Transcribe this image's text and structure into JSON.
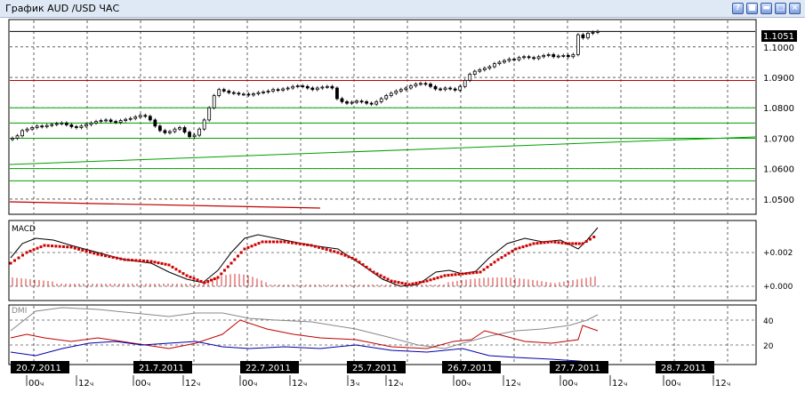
{
  "window": {
    "title": "График AUD /USD  ЧАС",
    "buttons": [
      "help-icon",
      "settings-icon",
      "minimize-icon",
      "maximize-icon",
      "close-icon"
    ],
    "button_glyphs": [
      "?",
      "■",
      "▬",
      "□",
      "×"
    ]
  },
  "price_panel": {
    "current_price": "1.1051",
    "ticks": [
      "1.1000",
      "1.0900",
      "1.0800",
      "1.0700",
      "1.0600",
      "1.0500"
    ]
  },
  "macd_panel": {
    "label": "MACD",
    "ticks": [
      "+0.002",
      "+0.000"
    ]
  },
  "dmi_panel": {
    "label": "DMI",
    "ticks": [
      "40",
      "20"
    ]
  },
  "time_axis": {
    "dates": [
      "20.7.2011",
      "21.7.2011",
      "22.7.2011",
      "25.7.2011",
      "26.7.2011",
      "27.7.2011",
      "28.7.2011"
    ],
    "hours": [
      {
        "h": "00",
        "m": "ч"
      },
      {
        "h": "12",
        "m": "ч"
      },
      {
        "h": "00",
        "m": "ч"
      },
      {
        "h": "12",
        "m": "ч"
      },
      {
        "h": "00",
        "m": "ч"
      },
      {
        "h": "12",
        "m": "ч"
      },
      {
        "h": "3",
        "m": "ч"
      },
      {
        "h": "12",
        "m": "ч"
      },
      {
        "h": "00",
        "m": "ч"
      },
      {
        "h": "12",
        "m": "ч"
      },
      {
        "h": "00",
        "m": "ч"
      },
      {
        "h": "12",
        "m": "ч"
      },
      {
        "h": "00",
        "m": "ч"
      },
      {
        "h": "12",
        "m": "ч"
      }
    ]
  },
  "colors": {
    "candle": "#000000",
    "support": "#00a000",
    "resistance": "#c00000",
    "macd_signal": "#cc0000",
    "dmi_gray": "#888888",
    "dmi_blue": "#0000aa"
  },
  "chart_data": {
    "type": "candlestick",
    "series_close": [
      1.07,
      1.0708,
      1.0725,
      1.073,
      1.0735,
      1.074,
      1.0738,
      1.0742,
      1.0745,
      1.0748,
      1.075,
      1.0744,
      1.0738,
      1.0735,
      1.074,
      1.0745,
      1.075,
      1.0755,
      1.0758,
      1.076,
      1.0755,
      1.0752,
      1.0758,
      1.0762,
      1.0765,
      1.077,
      1.0775,
      1.0772,
      1.076,
      1.074,
      1.0725,
      1.0718,
      1.0722,
      1.073,
      1.0735,
      1.072,
      1.0705,
      1.071,
      1.073,
      1.076,
      1.08,
      1.084,
      1.086,
      1.0855,
      1.085,
      1.0848,
      1.0845,
      1.0845,
      1.0842,
      1.0846,
      1.085,
      1.0852,
      1.0855,
      1.086,
      1.0858,
      1.0862,
      1.0865,
      1.087,
      1.0872,
      1.087,
      1.0865,
      1.086,
      1.0865,
      1.0868,
      1.087,
      1.0865,
      1.083,
      1.082,
      1.0815,
      1.0818,
      1.0822,
      1.082,
      1.0815,
      1.0812,
      1.082,
      1.083,
      1.084,
      1.0848,
      1.0855,
      1.086,
      1.0865,
      1.0872,
      1.0878,
      1.088,
      1.0878,
      1.087,
      1.0862,
      1.086,
      1.0865,
      1.0862,
      1.0858,
      1.087,
      1.089,
      1.091,
      1.092,
      1.0925,
      1.093,
      1.0935,
      1.0945,
      1.095,
      1.0955,
      1.096,
      1.0958,
      1.0965,
      1.0968,
      1.0965,
      1.0962,
      1.0968,
      1.0972,
      1.0975,
      1.0968,
      1.097,
      1.0972,
      1.0968,
      1.0975,
      1.104,
      1.103,
      1.1045,
      1.1048,
      1.1051
    ],
    "support_levels": [
      1.08,
      1.075,
      1.07,
      1.06,
      1.056
    ],
    "resistance_levels": [
      1.089
    ],
    "current_level": 1.1051
  }
}
